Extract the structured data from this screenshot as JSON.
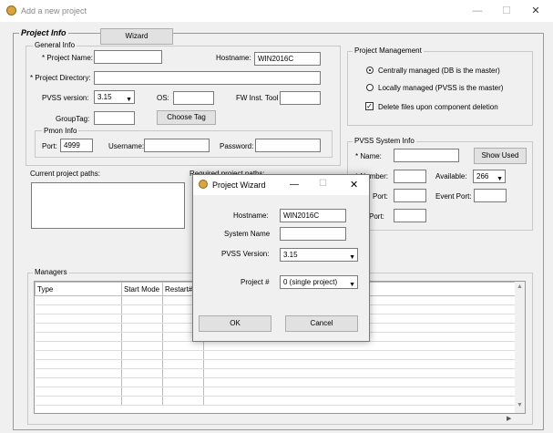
{
  "window": {
    "title": "Add a new project",
    "minimize": "—",
    "maximize": "☐",
    "close": "✕"
  },
  "project_info": {
    "title": "Project Info",
    "wizard_label": "Wizard",
    "general": {
      "title": "General Info",
      "project_name_label": "* Project Name:",
      "project_name_value": "",
      "hostname_label": "Hostname:",
      "hostname_value": "WIN2016C",
      "project_dir_label": "* Project Directory:",
      "project_dir_value": "",
      "pvss_version_label": "PVSS version:",
      "pvss_version_value": "3.15",
      "os_label": "OS:",
      "os_value": "",
      "fw_inst_label": "FW Inst. Tool",
      "fw_inst_value": "",
      "grouptag_label": "GroupTag:",
      "grouptag_value": "",
      "choose_tag_label": "Choose Tag"
    },
    "pmon": {
      "title": "Pmon Info",
      "port_label": "Port:",
      "port_value": "4999",
      "username_label": "Username:",
      "username_value": "",
      "password_label": "Password:",
      "password_value": ""
    },
    "paths": {
      "current_label": "Current project paths:",
      "required_label": "Required project paths:"
    },
    "management": {
      "title": "Project Management",
      "central_label": "Centrally managed (DB is the master)",
      "local_label": "Locally managed (PVSS is the master)",
      "delete_label": "Delete files upon component deletion"
    },
    "pvss_system": {
      "title": "PVSS System Info",
      "name_label": "* Name:",
      "name_value": "",
      "show_used_label": "Show Used",
      "number_label": "* Number:",
      "number_value": "",
      "available_label": "Available:",
      "available_value": "266",
      "port_label": "Port:",
      "port_value": "",
      "event_port_label": "Event Port:",
      "event_port_value": "",
      "port2_label": "Port:",
      "port2_value": ""
    },
    "managers": {
      "title": "Managers",
      "columns": [
        "Type",
        "Start Mode",
        "Restart#"
      ]
    }
  },
  "wizard_dialog": {
    "title": "Project Wizard",
    "minimize": "—",
    "maximize": "☐",
    "close": "✕",
    "hostname_label": "Hostname:",
    "hostname_value": "WIN2016C",
    "system_name_label": "System Name",
    "system_name_value": "",
    "pvss_version_label": "PVSS Version:",
    "pvss_version_value": "3.15",
    "project_num_label": "Project #",
    "project_num_value": "0 (single project)",
    "ok_label": "OK",
    "cancel_label": "Cancel"
  }
}
